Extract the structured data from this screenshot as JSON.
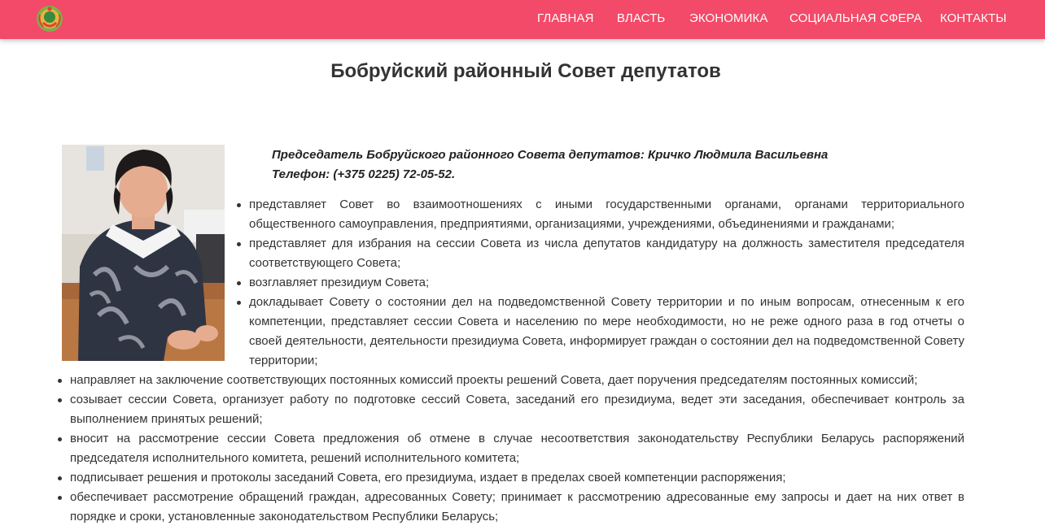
{
  "navbar": {
    "logo_icon": "belarus-emblem-icon",
    "items": [
      {
        "label": "ГЛАВНАЯ"
      },
      {
        "label": "ВЛАСТЬ"
      },
      {
        "label": "ЭКОНОМИКА"
      },
      {
        "label": "СОЦИАЛЬНАЯ СФЕРА"
      },
      {
        "label": "КОНТАКТЫ"
      }
    ],
    "background": "#f24a68"
  },
  "page": {
    "title": "Бобруйский районный Совет депутатов"
  },
  "chairman": {
    "title_line": "Председатель Бобруйского районного Совета депутатов: Кричко Людмила Васильевна",
    "phone_line": "Телефон: (+375 0225) 72-05-52."
  },
  "duties": [
    "представляет Совет во взаимоотношениях с иными государственными органами, органами территориального общественного самоуправления, предприятиями, организациями, учреждениями, объединениями и гражданами;",
    "представляет для избрания на сессии Совета из числа депутатов кандидатуру на должность заместителя председателя соответствующего Совета;",
    "возглавляет президиум Совета;",
    "докладывает Совету о состоянии дел на подведомственной Совету территории и по иным вопросам, отнесенным к его компетенции, представляет сессии Совета и населению по мере необходимости, но не реже одного раза в год отчеты о своей деятельности, деятельности президиума Совета, информирует граждан о состоянии дел на подведомственной Совету территории;",
    "направляет на заключение соответствующих постоянных комиссий проекты решений Совета, дает поручения председателям постоянных комиссий;",
    "созывает сессии Совета, организует работу по подготовке сессий Совета, заседаний его президиума, ведет эти заседания, обеспечивает контроль за выполнением принятых решений;",
    "вносит на рассмотрение сессии Совета предложения об отмене в случае несоответствия законодательству Республики Беларусь распоряжений председателя исполнительного комитета, решений исполнительного комитета;",
    "подписывает решения и протоколы заседаний Совета, его президиума, издает в пределах своей компетенции распоряжения;",
    "обеспечивает рассмотрение обращений граждан, адресованных Совету; принимает к рассмотрению адресованные ему запросы и дает на них ответ в порядке и сроки, установленные законодательством Республики Беларусь;"
  ]
}
